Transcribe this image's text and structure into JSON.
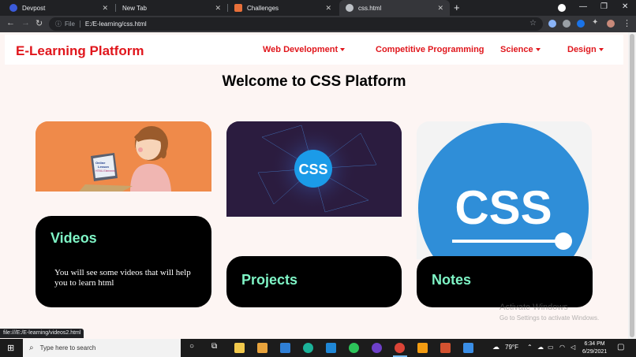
{
  "browser": {
    "tabs": [
      {
        "title": "Devpost",
        "favicon_color": "#3b5bdb"
      },
      {
        "title": "New Tab",
        "favicon_color": "#4285f4"
      },
      {
        "title": "Challenges",
        "favicon_color": "#e8703a"
      },
      {
        "title": "css.html",
        "favicon_color": "#bdc1c6"
      }
    ],
    "new_tab_label": "+",
    "address": {
      "scheme_label": "File",
      "url": "E:/E-learning/css.html"
    },
    "window_controls": [
      "—",
      "❐",
      "✕"
    ]
  },
  "site": {
    "brand": "E-Learning Platform",
    "menu": [
      {
        "label": "Web Development",
        "has_dropdown": true
      },
      {
        "label": "Competitive Programming",
        "has_dropdown": false
      },
      {
        "label": "Science",
        "has_dropdown": true
      },
      {
        "label": "Design",
        "has_dropdown": true
      }
    ],
    "heading": "Welcome to CSS Platform",
    "cards": [
      {
        "title": "Videos",
        "description": "You will see some videos that will help you to learn html",
        "image_text": [
          "Online",
          "Lesson",
          "HTML Elements"
        ]
      },
      {
        "title": "Projects",
        "image_text": "CSS"
      },
      {
        "title": "Notes",
        "image_text": "CSS"
      }
    ],
    "status_url": "file:///E:/E-learning/videos2.html"
  },
  "watermark": {
    "line1": "Activate Windows",
    "line2": "Go to Settings to activate Windows."
  },
  "taskbar": {
    "search_placeholder": "Type here to search",
    "weather": "79°F",
    "time": "6:34 PM",
    "date": "6/29/2021"
  },
  "colors": {
    "accent_red": "#e0161c",
    "card_title_mint": "#7ff5c6",
    "card_bg": "#000000",
    "page_bg": "#fdf5f3"
  }
}
